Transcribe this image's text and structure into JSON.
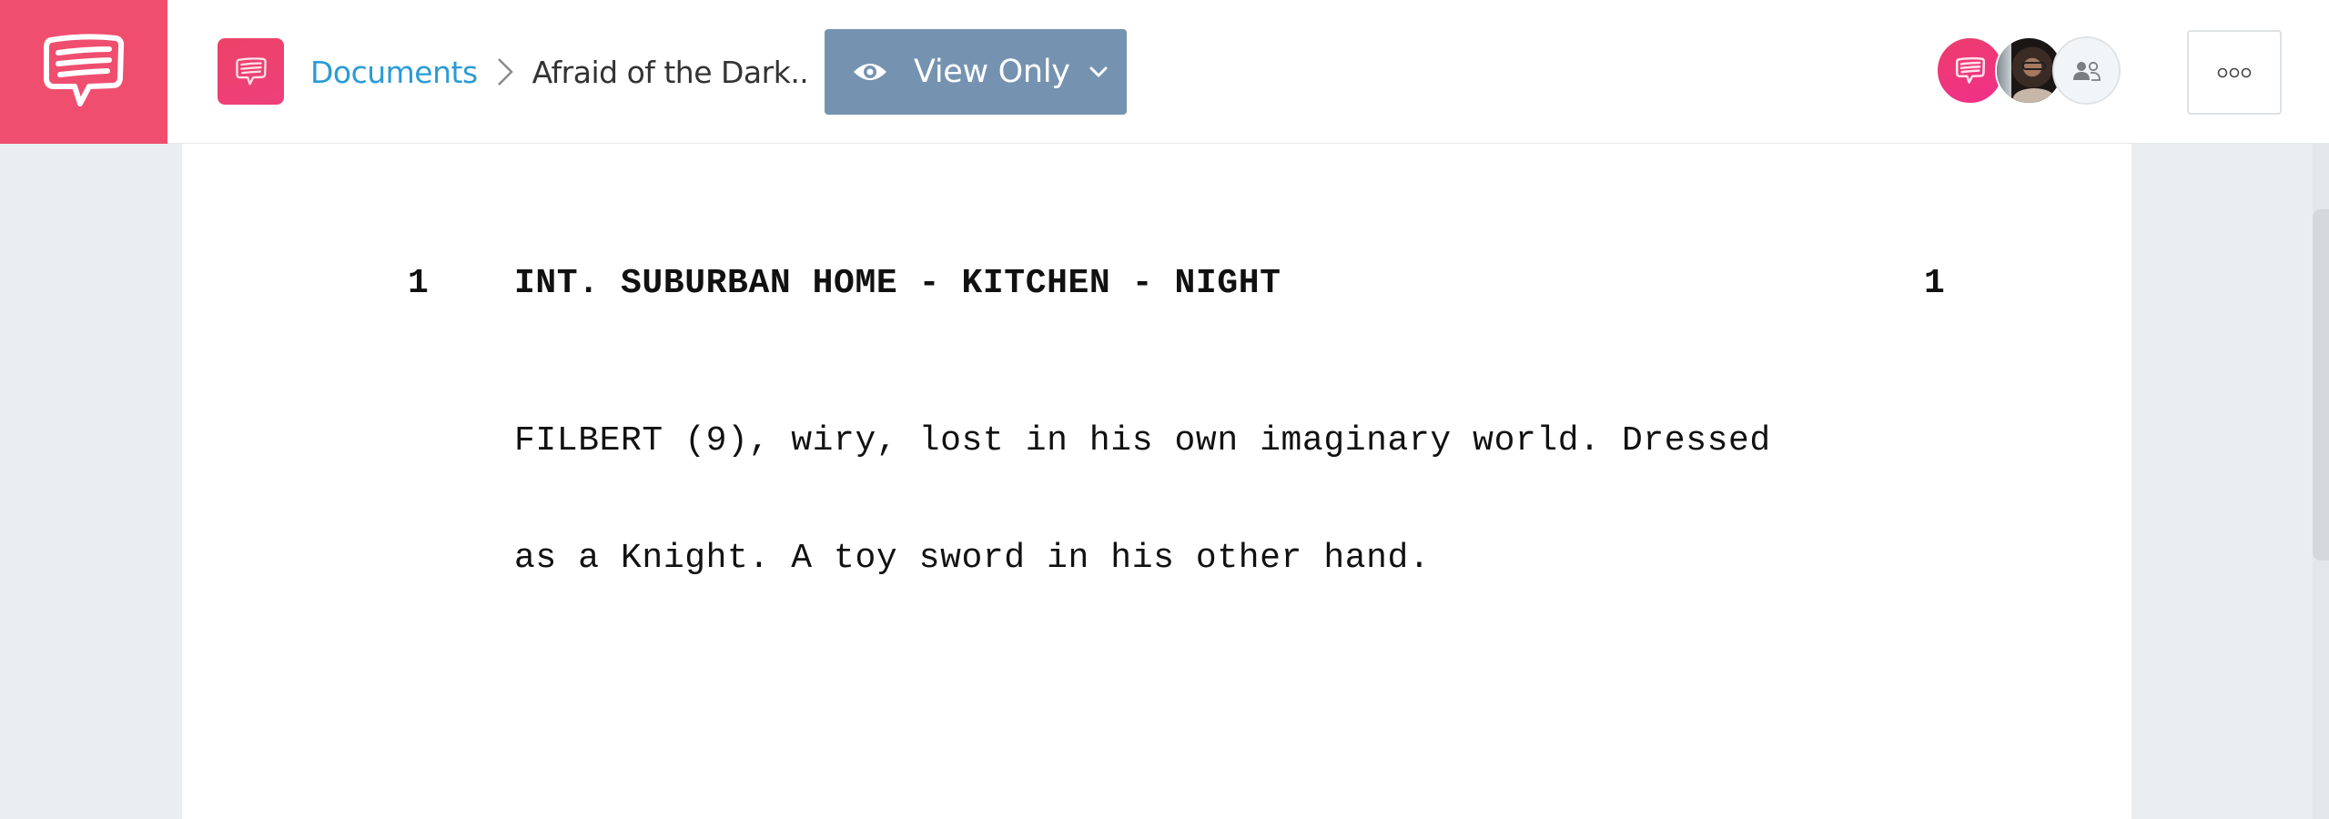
{
  "header": {
    "logo_icon": "speech-bubble-logo-icon",
    "document_icon": "speech-bubble-document-icon",
    "breadcrumb": {
      "root_label": "Documents",
      "separator_icon": "chevron-right-icon",
      "current_label": "Afraid of the Dark.."
    },
    "view_mode": {
      "icon": "eye-icon",
      "label": "View Only",
      "dropdown_icon": "chevron-down-icon"
    },
    "collaborators": [
      {
        "type": "brand",
        "icon": "speech-bubble-icon"
      },
      {
        "type": "user-photo"
      },
      {
        "type": "share",
        "icon": "people-icon"
      }
    ],
    "more_button_icon": "more-options-icon"
  },
  "script": {
    "scene_number_left": "1",
    "scene_number_right": "1",
    "scene_heading": "INT. SUBURBAN HOME - KITCHEN - NIGHT",
    "action_lines": [
      "FILBERT (9), wiry, lost in his own imaginary world. Dressed",
      "as a Knight. A toy sword in his other hand."
    ]
  },
  "colors": {
    "brand_pink": "#f04e6f",
    "link_blue": "#2a9bd6",
    "view_only_button": "#7593b0",
    "background_gray": "#ebeef1"
  }
}
